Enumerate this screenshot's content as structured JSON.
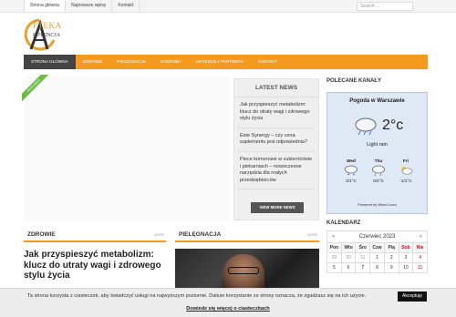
{
  "topbar": {
    "items": [
      "Strona główna",
      "Najnowsze wpisy",
      "Kontakt"
    ],
    "search_placeholder": "Search ..."
  },
  "logo": {
    "line1": "PTEKA",
    "line2": "POTENCJA"
  },
  "mainnav": {
    "items": [
      "STRONA GŁÓWNA",
      "ZDROWIE",
      "PIELĘGNACJA",
      "CHOROBY",
      "MATERIAŁY PARTNERA",
      "KONTAKT"
    ]
  },
  "slider": {
    "ribbon": "FEATURED"
  },
  "latest_news": {
    "title": "LATEST NEWS",
    "items": [
      "Jak przyspieszyć metabolizm: klucz do utraty wagi i zdrowego stylu życia",
      "Este Synergy – czy cena suplementu jest odpowiednia?",
      "Piece komorowe w cukiernictwie i piekarniach – nowoczesne narzędzia dla małych przedsiębiorców"
    ],
    "more_button": "VIEW MORE NEWS"
  },
  "sidebar": {
    "channels_title": "POLECANE KANAŁY",
    "weather": {
      "city": "Pogoda w Warszawie",
      "temp": "2°c",
      "desc": "Light rain",
      "days": [
        {
          "name": "Wed",
          "temp": "0/1°C"
        },
        {
          "name": "Thu",
          "temp": "0/2°C"
        },
        {
          "name": "Fri",
          "temp": "-1/1°C"
        }
      ],
      "powered": "Powered by Weer1.com"
    },
    "calendar_title": "KALENDARZ",
    "calendar": {
      "month": "Czerwiec 2023",
      "prev": "«",
      "next": "»",
      "dow": [
        "Pon",
        "Wto",
        "Śro",
        "Czw",
        "Pią",
        "Sob",
        "Nie"
      ],
      "week1": [
        "29",
        "30",
        "31",
        "1",
        "2",
        "3",
        "4"
      ],
      "week2": [
        "5",
        "6",
        "7",
        "8",
        "9",
        "10",
        "11"
      ]
    }
  },
  "categories": {
    "zdrowie": {
      "title": "ZDROWIE",
      "more": "MORE"
    },
    "pielegnacja": {
      "title": "PIELĘGNACJA",
      "more": "MORE"
    }
  },
  "article": {
    "title": "Jak przyspieszyć metabolizm: klucz do utraty wagi i zdrowego stylu życia"
  },
  "cookie": {
    "text": "Ta strona korzysta z ciasteczek, aby świadczyć usługi na najwyższym poziomie. Dalsze korzystanie ze strony oznacza, że zgadzasz się na ich użycie.",
    "accept": "Akceptuję",
    "link": "Dowiedz się więcej o ciasteczkach"
  },
  "colors": {
    "accent": "#f39a1f",
    "nav_active": "#444444",
    "ribbon": "#6cbd45"
  }
}
